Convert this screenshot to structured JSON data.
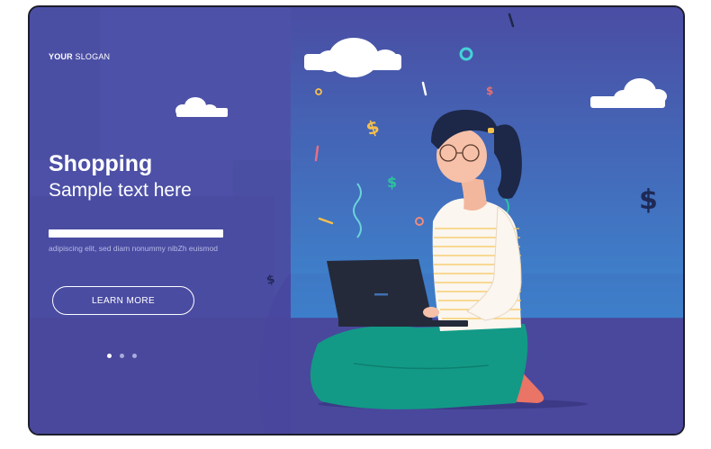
{
  "brand": {
    "slogan_bold": "YOUR",
    "slogan_rest": " SLOGAN"
  },
  "hero": {
    "title": "Shopping",
    "subtitle": "Sample text here",
    "body": "adipiscing elit, sed diam nonummy nibZh euismod",
    "button_label": "LEARN MORE"
  },
  "carousel": {
    "slide_count": 3,
    "active_index": 0
  },
  "colors": {
    "background": "#4b4fa4",
    "sky_light": "#3e7fcb",
    "floor": "#4a479c",
    "pants": "#129a86",
    "laptop": "#242a3a",
    "hair": "#1d2747"
  },
  "decorations": {
    "money_symbol": "$"
  }
}
